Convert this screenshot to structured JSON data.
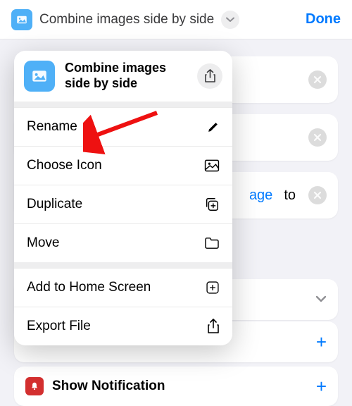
{
  "header": {
    "title": "Combine images side by side",
    "done_label": "Done"
  },
  "menu": {
    "title": "Combine images side by side",
    "items": [
      {
        "label": "Rename",
        "icon": "pencil-icon"
      },
      {
        "label": "Choose Icon",
        "icon": "image-icon"
      },
      {
        "label": "Duplicate",
        "icon": "duplicate-icon"
      },
      {
        "label": "Move",
        "icon": "folder-icon"
      }
    ],
    "items2": [
      {
        "label": "Add to Home Screen",
        "icon": "add-square-icon"
      },
      {
        "label": "Export File",
        "icon": "export-icon"
      }
    ]
  },
  "background": {
    "fragment_link": "age",
    "fragment_to": "to",
    "notification_label": "Show Notification"
  }
}
